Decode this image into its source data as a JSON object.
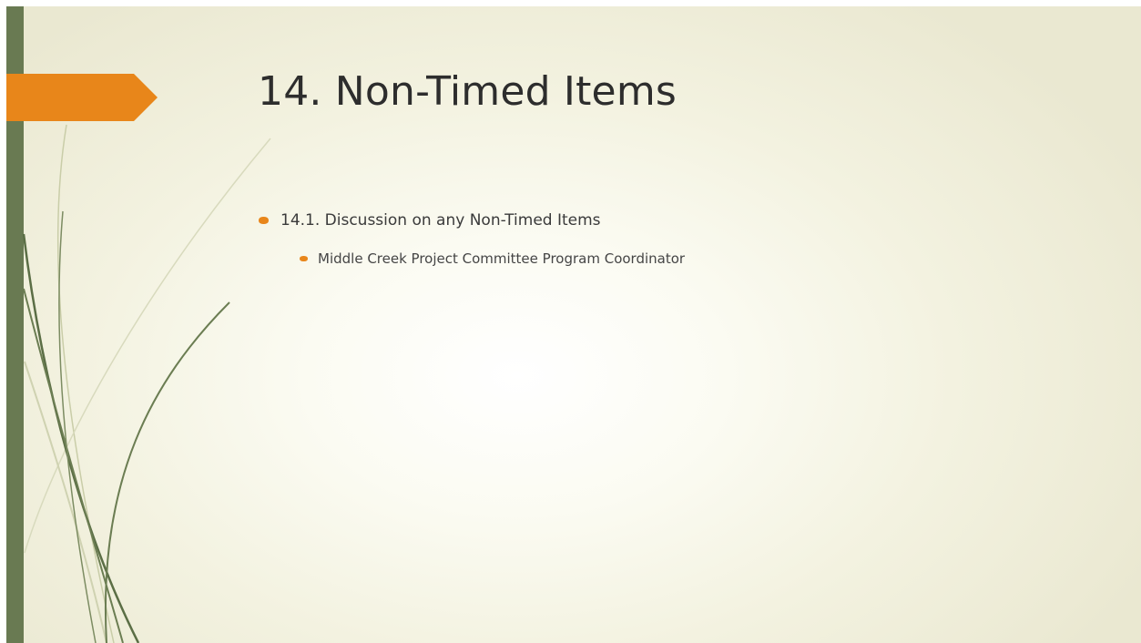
{
  "slide": {
    "title": "14. Non-Timed Items",
    "bullets": [
      {
        "text": "14.1. Discussion on any Non-Timed Items",
        "level": 1
      },
      {
        "text": "Middle Creek Project Committee Program Coordinator",
        "level": 2
      }
    ]
  },
  "theme": {
    "accent": "#e8861a",
    "bar": "#697a52",
    "grass_dark": "#5b6e45",
    "grass_light": "#c9cda8",
    "title_color": "#2d2d2d"
  }
}
